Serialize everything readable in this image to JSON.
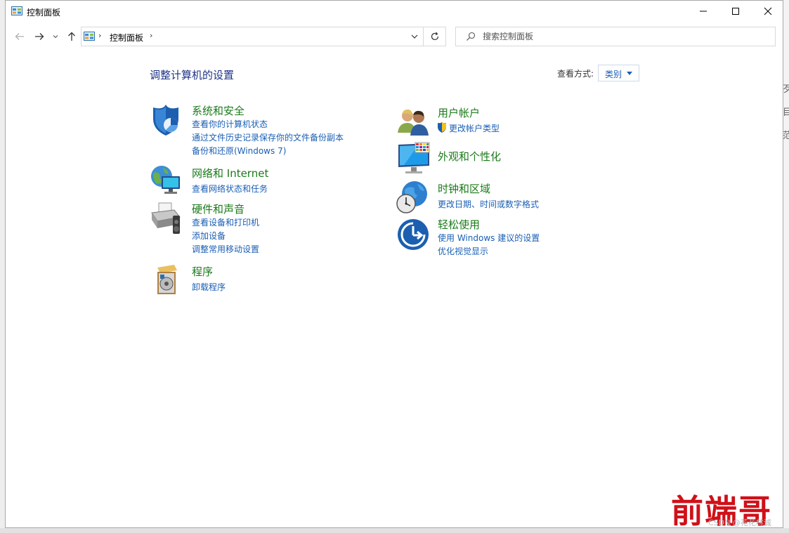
{
  "background": {
    "side_texts": [
      "歹",
      "目",
      "范"
    ]
  },
  "window": {
    "title": "控制面板",
    "caption_buttons": {
      "minimize": "minimize",
      "maximize": "maximize",
      "close": "close"
    }
  },
  "address_bar": {
    "breadcrumb": "控制面板",
    "search_placeholder": "搜索控制面板"
  },
  "content": {
    "page_title": "调整计算机的设置",
    "view_by_label": "查看方式:",
    "view_by_value": "类别"
  },
  "categories_left": [
    {
      "title": "系统和安全",
      "icon": "shield-icon",
      "links": [
        "查看你的计算机状态",
        "通过文件历史记录保存你的文件备份副本",
        "备份和还原(Windows 7)"
      ]
    },
    {
      "title": "网络和 Internet",
      "icon": "network-icon",
      "links": [
        "查看网络状态和任务"
      ]
    },
    {
      "title": "硬件和声音",
      "icon": "printer-icon",
      "links": [
        "查看设备和打印机",
        "添加设备",
        "调整常用移动设置"
      ]
    },
    {
      "title": "程序",
      "icon": "programs-icon",
      "links": [
        "卸载程序"
      ]
    }
  ],
  "categories_right": [
    {
      "title": "用户帐户",
      "icon": "users-icon",
      "links": [
        "更改帐户类型"
      ]
    },
    {
      "title": "外观和个性化",
      "icon": "monitor-icon",
      "links": []
    },
    {
      "title": "时钟和区域",
      "icon": "clock-globe-icon",
      "links": [
        "更改日期、时间或数字格式"
      ]
    },
    {
      "title": "轻松使用",
      "icon": "ease-of-access-icon",
      "links": [
        "使用 Windows 建议的设置",
        "优化视觉显示"
      ]
    }
  ],
  "watermark": {
    "brand": "前端哥",
    "credit": "CSDN @花花林诚"
  },
  "colors": {
    "category_title": "#1a7a1a",
    "link": "#1a5fb4",
    "page_title": "#1e3287"
  }
}
